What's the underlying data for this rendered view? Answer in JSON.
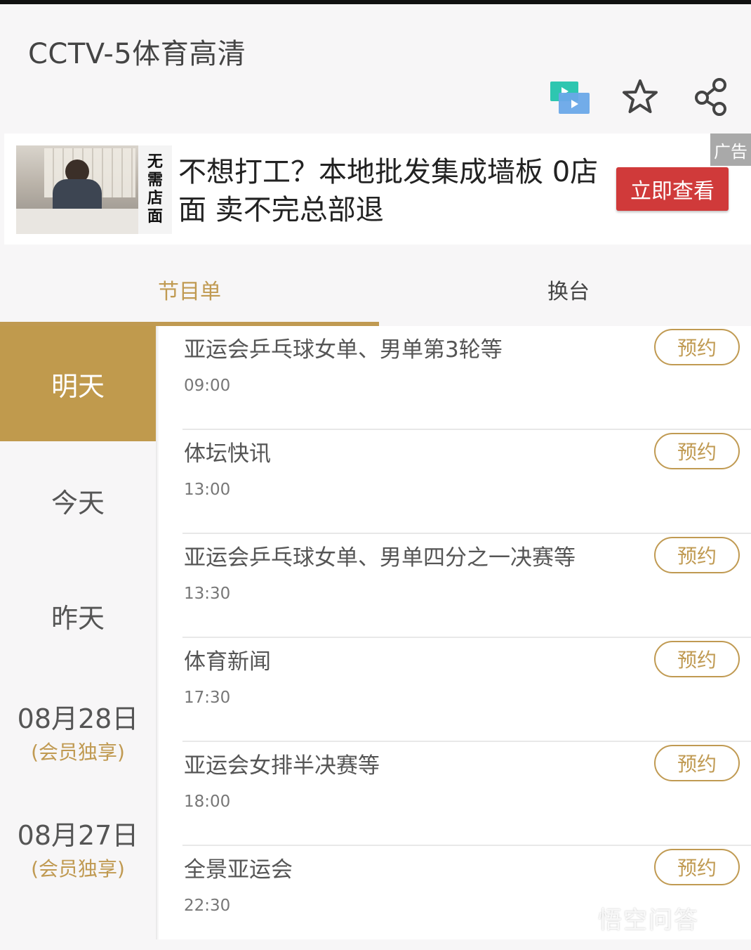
{
  "header": {
    "title": "CCTV-5体育高清",
    "icons": [
      "tv-cast-icon",
      "star-icon",
      "share-icon"
    ]
  },
  "ad": {
    "image_caption": [
      "无",
      "需",
      "店",
      "面"
    ],
    "text": "不想打工？本地批发集成墙板 0店面 卖不完总部退",
    "cta": "立即查看",
    "label": "广告"
  },
  "tabs": [
    {
      "label": "节目单",
      "active": true
    },
    {
      "label": "换台",
      "active": false
    }
  ],
  "days": [
    {
      "label": "明天",
      "sub": "",
      "active": true
    },
    {
      "label": "今天",
      "sub": ""
    },
    {
      "label": "昨天",
      "sub": ""
    },
    {
      "label": "08月28日",
      "sub": "(会员独享)"
    },
    {
      "label": "08月27日",
      "sub": "(会员独享)"
    }
  ],
  "programs": [
    {
      "name": "亚运会乒乓球女单、男单第3轮等",
      "time": "09:00",
      "action": "预约"
    },
    {
      "name": "体坛快讯",
      "time": "13:00",
      "action": "预约"
    },
    {
      "name": "亚运会乒乓球女单、男单四分之一决赛等",
      "time": "13:30",
      "action": "预约"
    },
    {
      "name": "体育新闻",
      "time": "17:30",
      "action": "预约"
    },
    {
      "name": "亚运会女排半决赛等",
      "time": "18:00",
      "action": "预约"
    },
    {
      "name": "全景亚运会",
      "time": "22:30",
      "action": "预约"
    }
  ],
  "watermark": "悟空问答",
  "colors": {
    "accent": "#c09a52",
    "active_day_bg": "#c09a4d",
    "ad_cta": "#d03a3a"
  }
}
